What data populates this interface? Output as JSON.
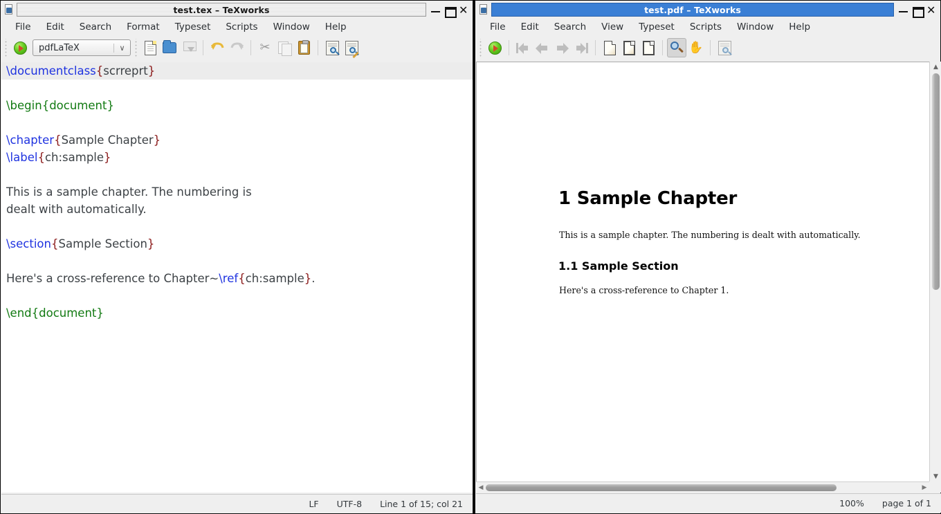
{
  "editor_window": {
    "title": "test.tex – TeXworks",
    "active": false,
    "window_icon": "document-icon",
    "window_buttons": {
      "minimize": "minimize-icon",
      "maximize": "maximize-icon",
      "close": "close-icon"
    },
    "menus": [
      "File",
      "Edit",
      "Search",
      "Format",
      "Typeset",
      "Scripts",
      "Window",
      "Help"
    ],
    "toolbar": {
      "typeset_button": "typeset-play-icon",
      "engine_selected": "pdfLaTeX",
      "buttons": [
        "new-document-icon",
        "open-file-icon",
        "save-file-icon",
        "undo-icon",
        "redo-icon",
        "cut-icon",
        "copy-icon",
        "paste-icon",
        "search-document-icon",
        "search-replace-icon"
      ]
    },
    "code_lines": [
      {
        "current": true,
        "tokens": [
          {
            "t": "cmd",
            "s": "\\documentclass"
          },
          {
            "t": "br",
            "s": "{"
          },
          {
            "t": "txt",
            "s": "scrreprt"
          },
          {
            "t": "br",
            "s": "}"
          }
        ]
      },
      {
        "current": false,
        "tokens": []
      },
      {
        "current": false,
        "tokens": [
          {
            "t": "env",
            "s": "\\begin{document}"
          }
        ]
      },
      {
        "current": false,
        "tokens": []
      },
      {
        "current": false,
        "tokens": [
          {
            "t": "cmd",
            "s": "\\chapter"
          },
          {
            "t": "br",
            "s": "{"
          },
          {
            "t": "txt",
            "s": "Sample Chapter"
          },
          {
            "t": "br",
            "s": "}"
          }
        ]
      },
      {
        "current": false,
        "tokens": [
          {
            "t": "cmd",
            "s": "\\label"
          },
          {
            "t": "br",
            "s": "{"
          },
          {
            "t": "txt",
            "s": "ch:sample"
          },
          {
            "t": "br",
            "s": "}"
          }
        ]
      },
      {
        "current": false,
        "tokens": []
      },
      {
        "current": false,
        "tokens": [
          {
            "t": "txt",
            "s": "This is a sample chapter. The numbering is"
          }
        ]
      },
      {
        "current": false,
        "tokens": [
          {
            "t": "txt",
            "s": "dealt with automatically."
          }
        ]
      },
      {
        "current": false,
        "tokens": []
      },
      {
        "current": false,
        "tokens": [
          {
            "t": "cmd",
            "s": "\\section"
          },
          {
            "t": "br",
            "s": "{"
          },
          {
            "t": "txt",
            "s": "Sample Section"
          },
          {
            "t": "br",
            "s": "}"
          }
        ]
      },
      {
        "current": false,
        "tokens": []
      },
      {
        "current": false,
        "tokens": [
          {
            "t": "txt",
            "s": "Here's a cross-reference to Chapter~"
          },
          {
            "t": "cmd",
            "s": "\\ref"
          },
          {
            "t": "br",
            "s": "{"
          },
          {
            "t": "txt",
            "s": "ch:sample"
          },
          {
            "t": "br",
            "s": "}"
          },
          {
            "t": "txt",
            "s": "."
          }
        ]
      },
      {
        "current": false,
        "tokens": []
      },
      {
        "current": false,
        "tokens": [
          {
            "t": "env",
            "s": "\\end{document}"
          }
        ]
      }
    ],
    "statusbar": {
      "line_ending": "LF",
      "encoding": "UTF-8",
      "position": "Line 1 of 15; col 21"
    }
  },
  "pdf_window": {
    "title": "test.pdf – TeXworks",
    "active": true,
    "window_icon": "document-icon",
    "window_buttons": {
      "minimize": "minimize-icon",
      "maximize": "maximize-icon",
      "close": "close-icon"
    },
    "menus": [
      "File",
      "Edit",
      "Search",
      "View",
      "Typeset",
      "Scripts",
      "Window",
      "Help"
    ],
    "toolbar": {
      "typeset_button": "typeset-play-icon",
      "buttons": [
        "first-page-icon",
        "previous-page-icon",
        "next-page-icon",
        "last-page-icon",
        "fit-width-icon",
        "fit-window-icon",
        "actual-size-icon",
        "magnify-tool-icon",
        "pan-tool-icon",
        "source-search-icon"
      ],
      "active_tool": "magnify-tool-icon"
    },
    "page": {
      "chapter_heading": "1  Sample Chapter",
      "chapter_paragraph": "This is a sample chapter.  The numbering is dealt with automatically.",
      "section_heading": "1.1  Sample Section",
      "section_paragraph": "Here's a cross-reference to Chapter 1."
    },
    "statusbar": {
      "zoom": "100%",
      "page": "page 1 of 1"
    }
  },
  "colors": {
    "active_title_bar": "#3a7fd5",
    "chrome": "#efefef",
    "command_blue": "#1f33e0",
    "brace_dark_red": "#8b1a1a",
    "environment_green": "#127a12",
    "code_text": "#3d4246"
  }
}
